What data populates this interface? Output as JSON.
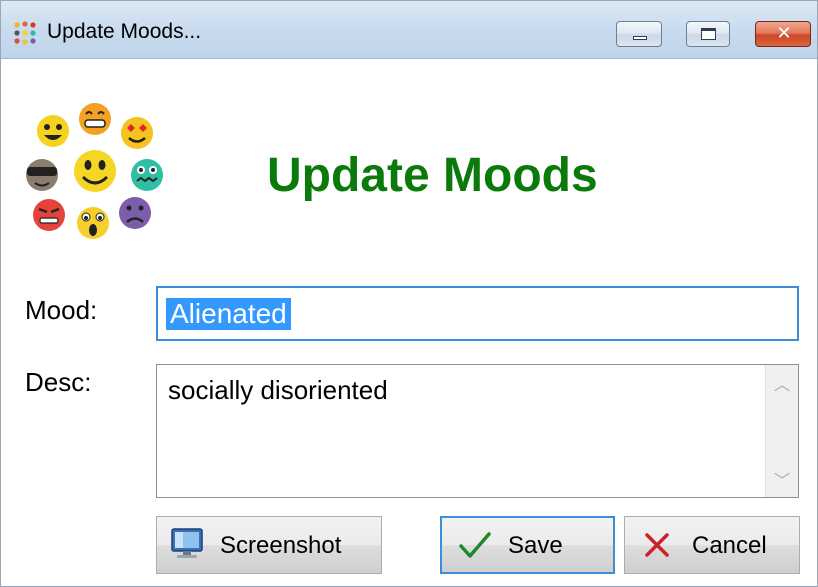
{
  "window": {
    "title": "Update Moods...",
    "controls": [
      "minimize-icon",
      "maximize-icon",
      "close-icon"
    ]
  },
  "header": {
    "heading": "Update Moods",
    "logo_icon": "emoji-faces-cluster-icon"
  },
  "form": {
    "mood_label": "Mood:",
    "mood_value": "Alienated",
    "desc_label": "Desc:",
    "desc_value": "socially disoriented"
  },
  "buttons": {
    "screenshot_label": "Screenshot",
    "save_label": "Save",
    "cancel_label": "Cancel"
  },
  "colors": {
    "heading": "#0a7a0a",
    "focus_border": "#3c8fd6",
    "selection": "#3399ff",
    "close_button": "#cc4726"
  }
}
